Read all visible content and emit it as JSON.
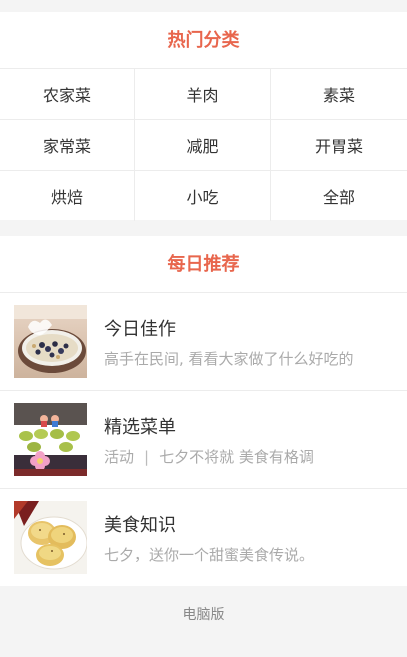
{
  "hot_categories": {
    "title": "热门分类",
    "items": [
      "农家菜",
      "羊肉",
      "素菜",
      "家常菜",
      "减肥",
      "开胃菜",
      "烘焙",
      "小吃",
      "全部"
    ]
  },
  "daily": {
    "title": "每日推荐",
    "items": [
      {
        "title": "今日佳作",
        "desc": "高手在民间, 看看大家做了什么好吃的",
        "image_icon": "yogurt-blueberry-bowl"
      },
      {
        "title": "精选菜单",
        "desc_parts": [
          "活动",
          "|",
          "七夕不将就  美食有格调"
        ],
        "image_icon": "matcha-pastries-with-flowers"
      },
      {
        "title": "美食知识",
        "desc": "七夕，送你一个甜蜜美食传说。",
        "image_icon": "golden-mooncakes"
      }
    ]
  },
  "footer": {
    "desktop_link": "电脑版"
  },
  "colors": {
    "accent": "#e8664d",
    "divider": "#ececec",
    "page_bg": "#f4f4f4"
  }
}
